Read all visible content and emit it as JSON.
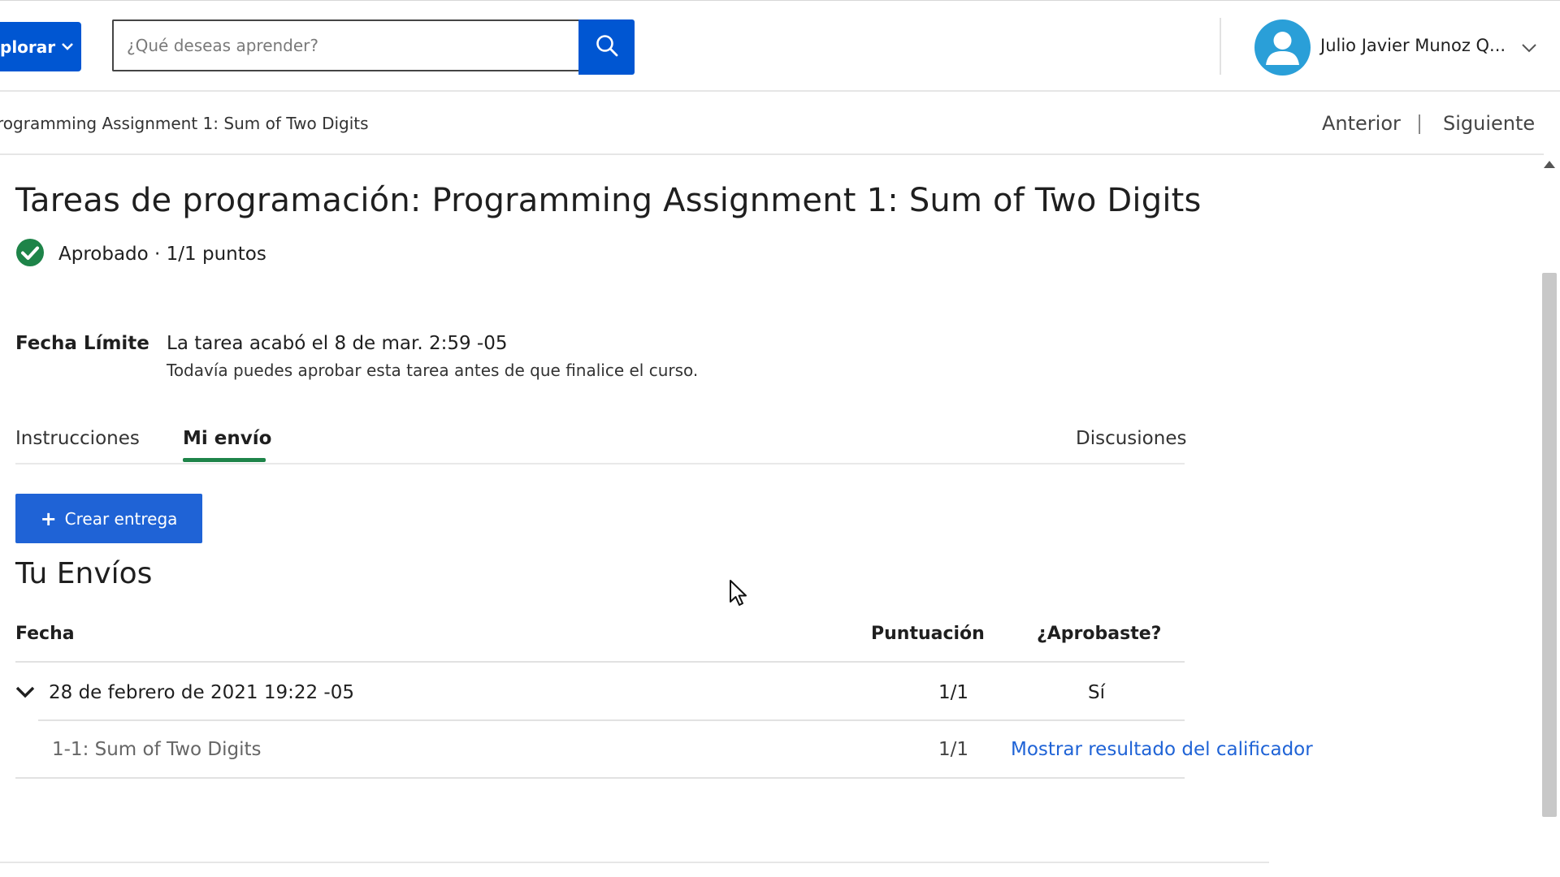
{
  "header": {
    "explore_label": "plorar",
    "search_placeholder": "¿Qué deseas aprender?",
    "user_name": "Julio Javier Munoz Q..."
  },
  "breadcrumb": {
    "current": "rogramming Assignment 1: Sum of Two Digits"
  },
  "item_nav": {
    "previous": "Anterior",
    "next": "Siguiente"
  },
  "assignment": {
    "title": "Tareas de programación: Programming Assignment 1: Sum of Two Digits",
    "status": "Aprobado · 1/1 puntos",
    "due_label": "Fecha Límite",
    "due_text": "La tarea acabó el 8 de mar. 2:59 -05",
    "due_note": "Todavía puedes aprobar esta tarea antes de que finalice el curso."
  },
  "tabs": [
    {
      "label": "Instrucciones",
      "active": false
    },
    {
      "label": "Mi envío",
      "active": true
    },
    {
      "label": "Discusiones",
      "active": false
    }
  ],
  "create_button": "Crear entrega",
  "submissions": {
    "title": "Tu Envíos",
    "columns": [
      "Fecha",
      "Puntuación",
      "¿Aprobaste?"
    ],
    "rows": [
      {
        "date": "28 de febrero de 2021 19:22 -05",
        "score": "1/1",
        "passed": "Sí",
        "parts": [
          {
            "name": "1-1: Sum of Two Digits",
            "score": "1/1",
            "action": "Mostrar resultado del calificador"
          }
        ]
      }
    ]
  },
  "colors": {
    "primary": "#0056d2",
    "button_blue": "#1f63d6",
    "success_green": "#1e8449",
    "avatar_blue": "#2a9fd8"
  },
  "icons": {
    "search": "magnifier",
    "status": "check-circle",
    "avatar": "person",
    "expand": "chevron-down"
  }
}
